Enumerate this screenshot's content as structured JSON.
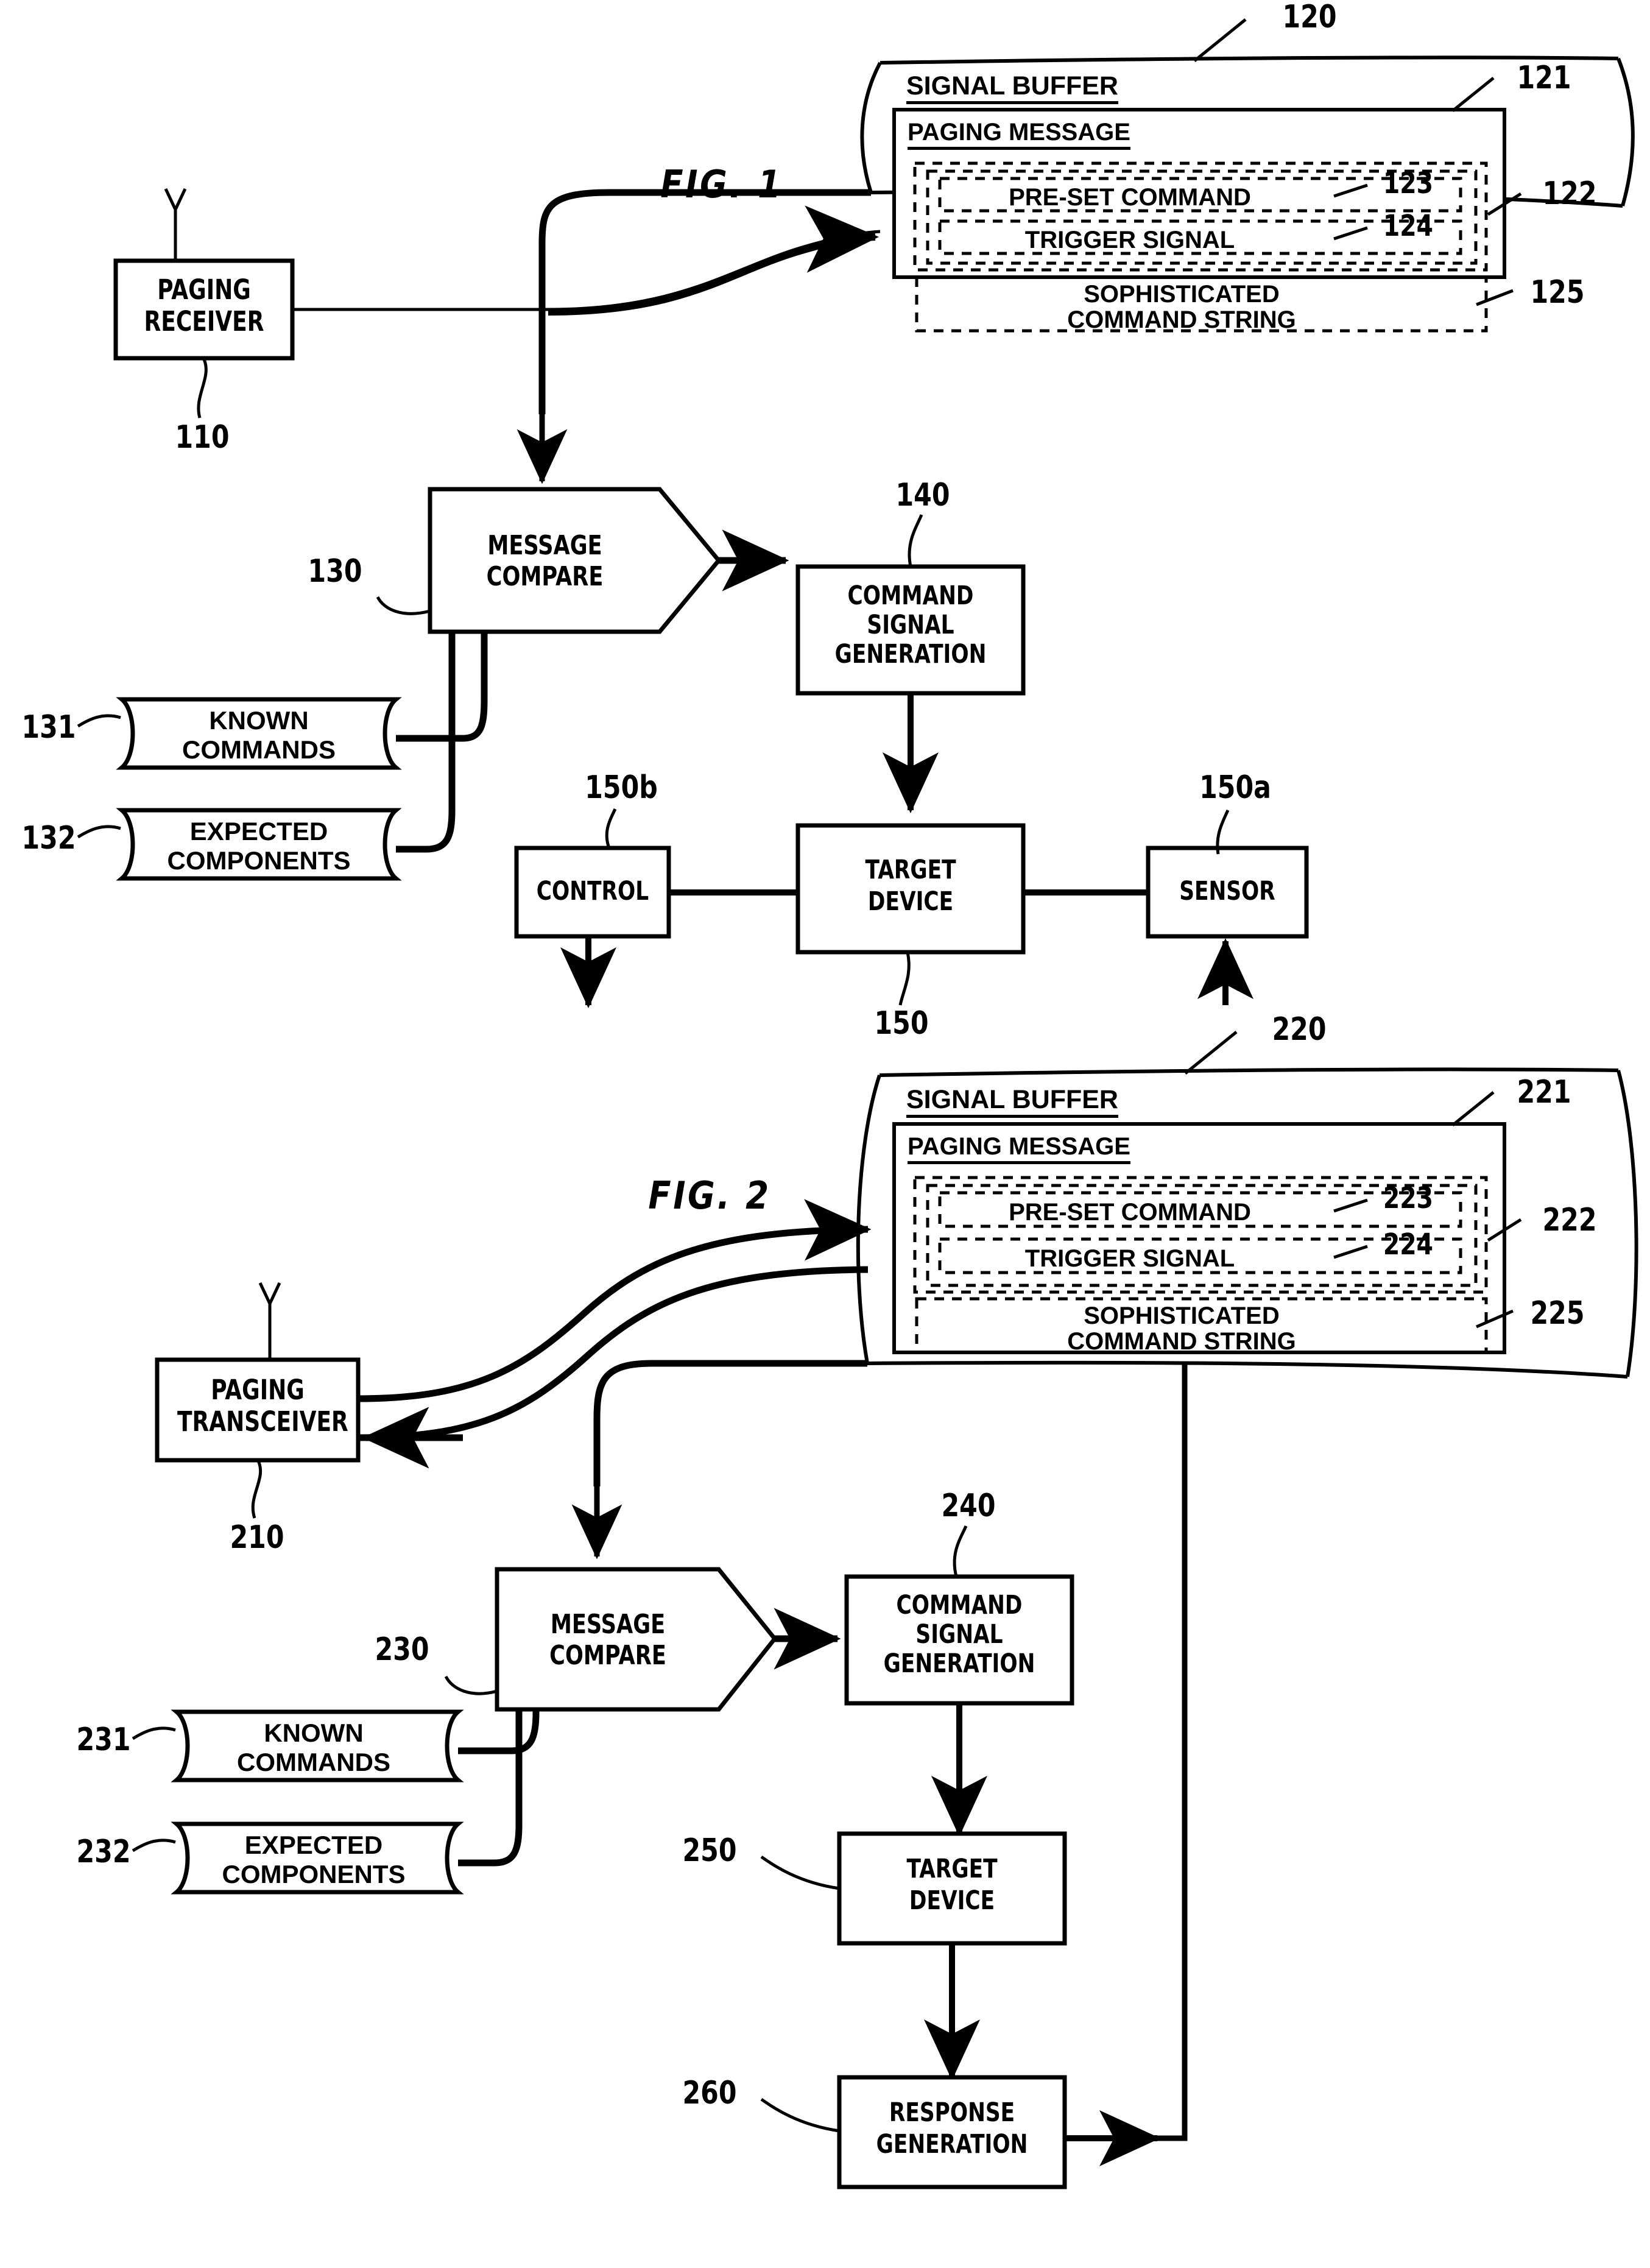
{
  "figures": [
    {
      "id": "fig1",
      "label": "FIG. 1",
      "signal_buffer": {
        "title": "SIGNAL BUFFER",
        "ref": "120",
        "paging_message": {
          "title": "PAGING MESSAGE",
          "ref": "121",
          "outer_dashed_ref": "122",
          "fields": [
            {
              "label": "PRE-SET COMMAND",
              "ref": "123"
            },
            {
              "label": "TRIGGER SIGNAL",
              "ref": "124"
            },
            {
              "label": "SOPHISTICATED\nCOMMAND STRING",
              "ref": "125"
            }
          ]
        }
      },
      "blocks": [
        {
          "name": "paging-receiver",
          "label": "PAGING\nRECEIVER",
          "ref": "110"
        },
        {
          "name": "message-compare",
          "label": "MESSAGE\nCOMPARE",
          "ref": "130"
        },
        {
          "name": "known-commands",
          "label": "KNOWN\nCOMMANDS",
          "ref": "131"
        },
        {
          "name": "expected-components",
          "label": "EXPECTED\nCOMPONENTS",
          "ref": "132"
        },
        {
          "name": "command-signal-generation",
          "label": "COMMAND\nSIGNAL\nGENERATION",
          "ref": "140"
        },
        {
          "name": "control",
          "label": "CONTROL",
          "ref": "150b"
        },
        {
          "name": "target-device",
          "label": "TARGET\nDEVICE",
          "ref": "150"
        },
        {
          "name": "sensor",
          "label": "SENSOR",
          "ref": "150a"
        }
      ]
    },
    {
      "id": "fig2",
      "label": "FIG. 2",
      "signal_buffer": {
        "title": "SIGNAL BUFFER",
        "ref": "220",
        "paging_message": {
          "title": "PAGING MESSAGE",
          "ref": "221",
          "outer_dashed_ref": "222",
          "fields": [
            {
              "label": "PRE-SET COMMAND",
              "ref": "223"
            },
            {
              "label": "TRIGGER SIGNAL",
              "ref": "224"
            },
            {
              "label": "SOPHISTICATED\nCOMMAND STRING",
              "ref": "225"
            }
          ]
        }
      },
      "blocks": [
        {
          "name": "paging-transceiver",
          "label": "PAGING\nTRANSCEIVER",
          "ref": "210"
        },
        {
          "name": "message-compare",
          "label": "MESSAGE\nCOMPARE",
          "ref": "230"
        },
        {
          "name": "known-commands",
          "label": "KNOWN\nCOMMANDS",
          "ref": "231"
        },
        {
          "name": "expected-components",
          "label": "EXPECTED\nCOMPONENTS",
          "ref": "232"
        },
        {
          "name": "command-signal-generation",
          "label": "COMMAND\nSIGNAL\nGENERATION",
          "ref": "240"
        },
        {
          "name": "target-device",
          "label": "TARGET\nDEVICE",
          "ref": "250"
        },
        {
          "name": "response-generation",
          "label": "RESPONSE\nGENERATION",
          "ref": "260"
        }
      ]
    }
  ],
  "fig1": {
    "label": "FIG. 1",
    "sb_title": "SIGNAL BUFFER",
    "sb_ref": "120",
    "pm_title": "PAGING MESSAGE",
    "pm_ref": "121",
    "outer_ref": "122",
    "f1_label": "PRE-SET COMMAND",
    "f1_ref": "123",
    "f2_label": "TRIGGER SIGNAL",
    "f2_ref": "124",
    "f3_line1": "SOPHISTICATED",
    "f3_line2": "COMMAND STRING",
    "f3_ref": "125",
    "recv_l1": "PAGING",
    "recv_l2": "RECEIVER",
    "recv_ref": "110",
    "mc_l1": "MESSAGE",
    "mc_l2": "COMPARE",
    "mc_ref": "130",
    "kc_l1": "KNOWN",
    "kc_l2": "COMMANDS",
    "kc_ref": "131",
    "ec_l1": "EXPECTED",
    "ec_l2": "COMPONENTS",
    "ec_ref": "132",
    "csg_l1": "COMMAND",
    "csg_l2": "SIGNAL",
    "csg_l3": "GENERATION",
    "csg_ref": "140",
    "ctrl_label": "CONTROL",
    "ctrl_ref": "150b",
    "td_l1": "TARGET",
    "td_l2": "DEVICE",
    "td_ref": "150",
    "sensor_label": "SENSOR",
    "sensor_ref": "150a"
  },
  "fig2": {
    "label": "FIG. 2",
    "sb_title": "SIGNAL BUFFER",
    "sb_ref": "220",
    "pm_title": "PAGING MESSAGE",
    "pm_ref": "221",
    "outer_ref": "222",
    "f1_label": "PRE-SET COMMAND",
    "f1_ref": "223",
    "f2_label": "TRIGGER SIGNAL",
    "f2_ref": "224",
    "f3_line1": "SOPHISTICATED",
    "f3_line2": "COMMAND STRING",
    "f3_ref": "225",
    "trx_l1": "PAGING",
    "trx_l2": "TRANSCEIVER",
    "trx_ref": "210",
    "mc_l1": "MESSAGE",
    "mc_l2": "COMPARE",
    "mc_ref": "230",
    "kc_l1": "KNOWN",
    "kc_l2": "COMMANDS",
    "kc_ref": "231",
    "ec_l1": "EXPECTED",
    "ec_l2": "COMPONENTS",
    "ec_ref": "232",
    "csg_l1": "COMMAND",
    "csg_l2": "SIGNAL",
    "csg_l3": "GENERATION",
    "csg_ref": "240",
    "td_l1": "TARGET",
    "td_l2": "DEVICE",
    "td_ref": "250",
    "rg_l1": "RESPONSE",
    "rg_l2": "GENERATION",
    "rg_ref": "260"
  },
  "colors": {
    "ink": "#000000",
    "paper": "#ffffff"
  }
}
